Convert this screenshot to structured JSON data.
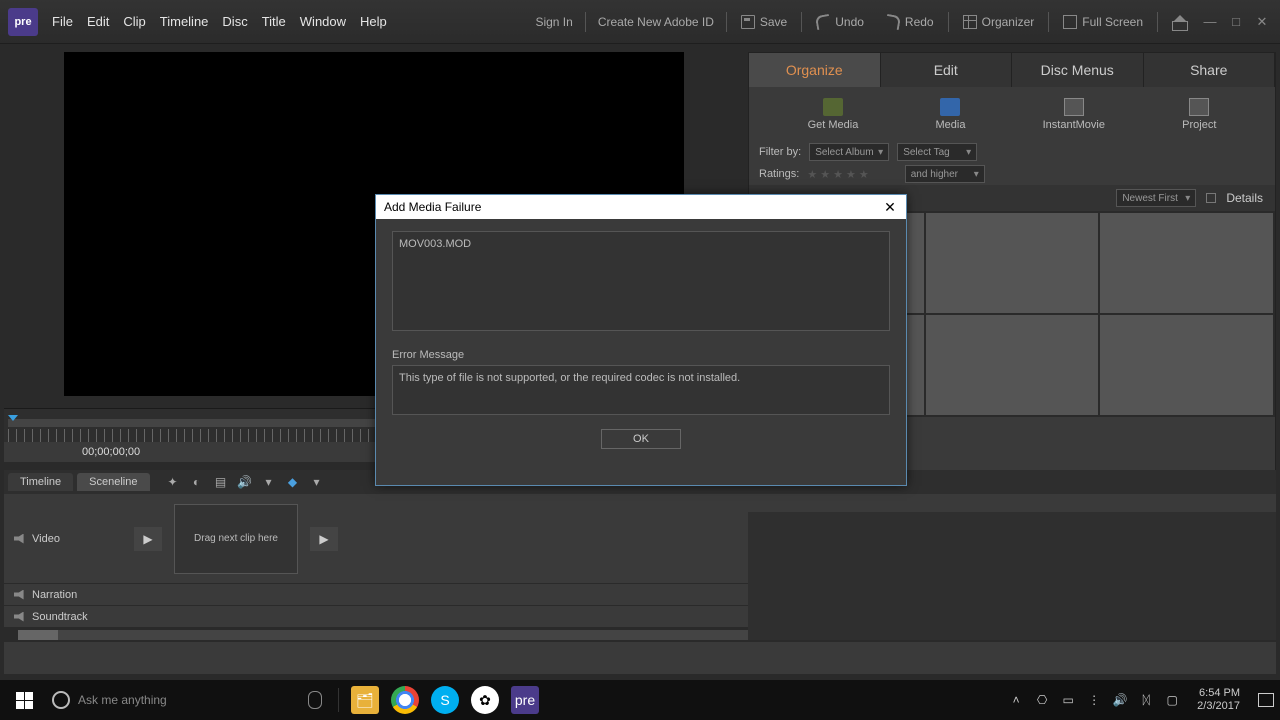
{
  "app_logo": "pre",
  "menus": [
    "File",
    "Edit",
    "Clip",
    "Timeline",
    "Disc",
    "Title",
    "Window",
    "Help"
  ],
  "top_right": {
    "signin": "Sign In",
    "create_id": "Create New Adobe ID",
    "save": "Save",
    "undo": "Undo",
    "redo": "Redo",
    "organizer": "Organizer",
    "fullscreen": "Full Screen"
  },
  "right_panel": {
    "tabs": [
      "Organize",
      "Edit",
      "Disc Menus",
      "Share"
    ],
    "org_buttons": [
      "Get Media",
      "Media",
      "InstantMovie",
      "Project"
    ],
    "filter_label": "Filter by:",
    "select_album": "Select Album",
    "select_tag": "Select Tag",
    "ratings_label": "Ratings:",
    "and_higher": "and higher",
    "sort": "Newest First",
    "details": "Details"
  },
  "timecode": "00;00;00;00",
  "timeline": {
    "tabs": [
      "Timeline",
      "Sceneline"
    ],
    "video": "Video",
    "drop": "Drag next clip here",
    "narration": "Narration",
    "soundtrack": "Soundtrack"
  },
  "modal": {
    "title": "Add Media Failure",
    "file": "MOV003.MOD",
    "err_label": "Error Message",
    "err_text": "This type of file is not supported, or the required codec is not installed.",
    "ok": "OK"
  },
  "taskbar": {
    "search_placeholder": "Ask me anything",
    "time": "6:54 PM",
    "date": "2/3/2017"
  }
}
